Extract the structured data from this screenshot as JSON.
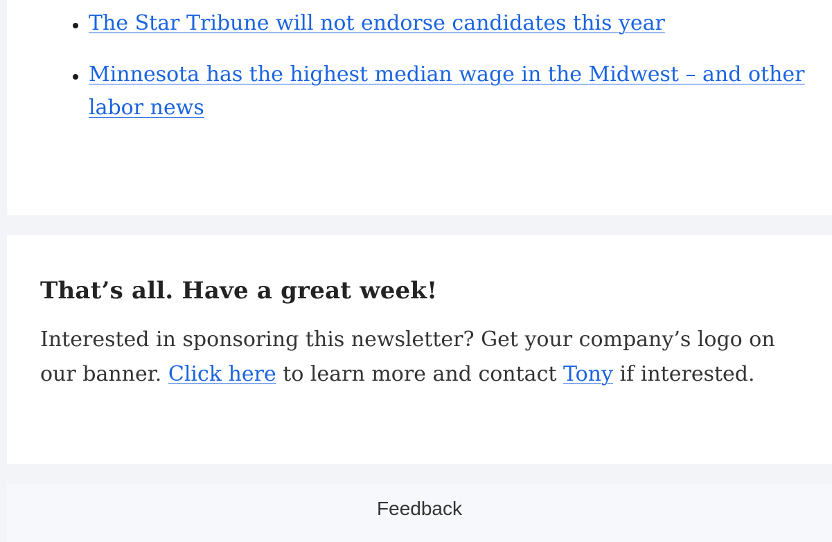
{
  "links_section": {
    "items": [
      {
        "text": "The Star Tribune will not endorse candidates this year"
      },
      {
        "text": "Minnesota has the highest median wage in the Midwest – and other labor news"
      }
    ]
  },
  "signoff": {
    "title": "That’s all. Have a great week!",
    "text_before_link": "Interested in sponsoring this newsletter? Get your company’s logo on our banner.",
    "click_here_label": "Click here",
    "text_middle": "to learn more and contact",
    "tony_label": "Tony",
    "text_after": "if interested."
  },
  "footer": {
    "feedback_label": "Feedback"
  },
  "colors": {
    "link": "#1a64e0",
    "page_background": "#f2f4f8",
    "card_background": "#ffffff"
  }
}
